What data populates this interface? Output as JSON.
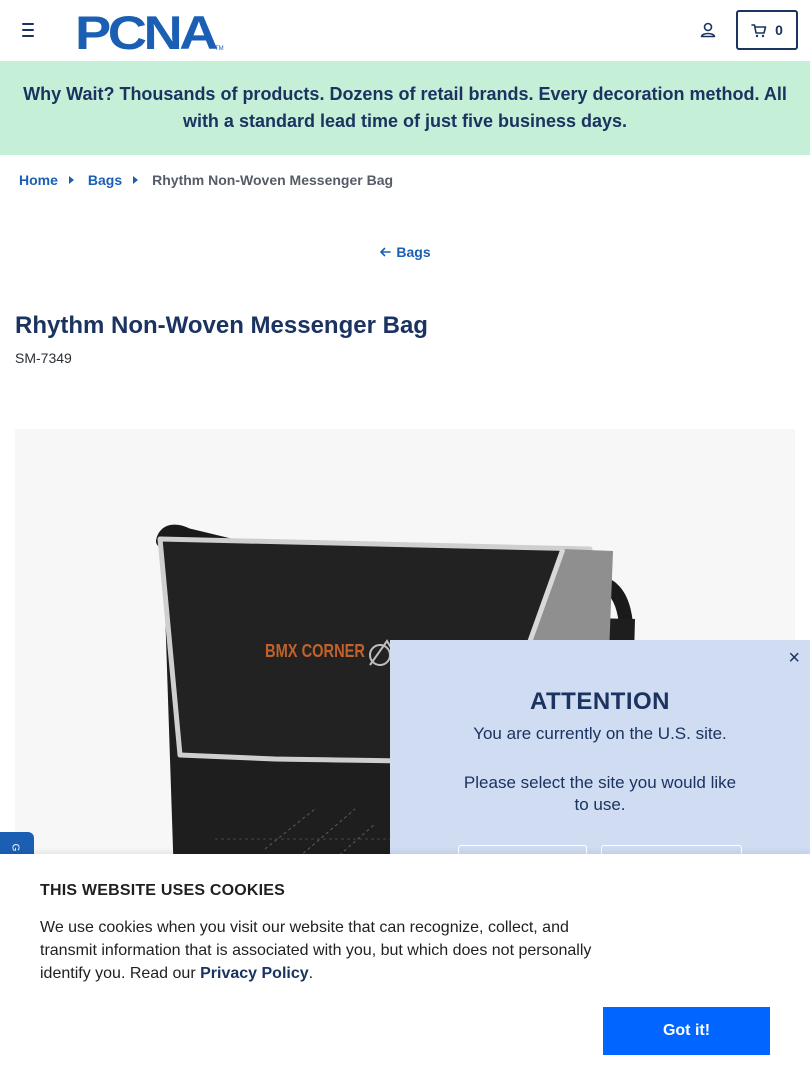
{
  "header": {
    "logo_text": "PCNA",
    "logo_tm": "TM",
    "cart_count": "0"
  },
  "promo": {
    "text": "Why Wait? Thousands of products. Dozens of retail brands. Every decoration method. All with a standard lead time of just five business days."
  },
  "breadcrumb": {
    "items": [
      "Home",
      "Bags"
    ],
    "current": "Rhythm Non-Woven Messenger Bag"
  },
  "back_link": {
    "label": "Bags"
  },
  "product": {
    "title": "Rhythm Non-Woven Messenger Bag",
    "sku": "SM-7349",
    "imprint_text": "BMX CORNER"
  },
  "popup": {
    "title": "ATTENTION",
    "subtitle": "You are currently on the U.S. site.",
    "prompt": "Please select the site you would like to use."
  },
  "cookie": {
    "title": "THIS WEBSITE USES COOKIES",
    "text": "We use cookies when you visit our website that can recognize, collect, and transmit information that is associated with you, but which does not personally identify you. Read our",
    "link": "Privacy Policy",
    "period": ".",
    "button": "Got it!"
  },
  "colors": {
    "navy": "#1b3360",
    "link_blue": "#1b5fb5",
    "promo_bg": "#c5efd7",
    "popup_bg": "#cfdcf2",
    "cookie_button": "#0066ff"
  }
}
